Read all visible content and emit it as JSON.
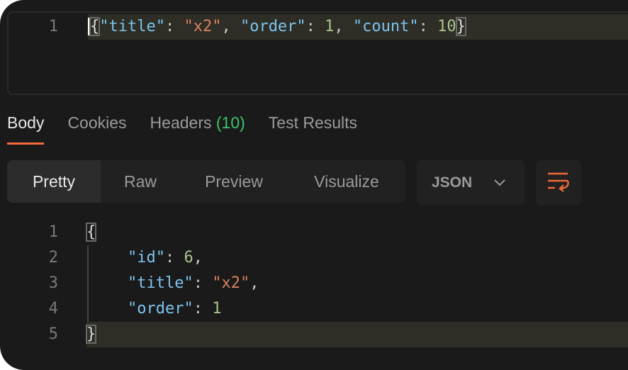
{
  "request": {
    "line_numbers": [
      "1"
    ],
    "open": "{",
    "k1": "\"title\"",
    "c1": ": ",
    "v1": "\"x2\"",
    "c2": ", ",
    "k2": "\"order\"",
    "c3": ": ",
    "v2": "1",
    "c4": ", ",
    "k3": "\"count\"",
    "c5": ": ",
    "v3": "10",
    "close": "}"
  },
  "tabs": [
    {
      "label": "Body"
    },
    {
      "label": "Cookies"
    },
    {
      "label": "Headers",
      "count": "(10)"
    },
    {
      "label": "Test Results"
    }
  ],
  "view_modes": [
    "Pretty",
    "Raw",
    "Preview",
    "Visualize"
  ],
  "format": {
    "selected": "JSON",
    "icon": "chevron-down-icon"
  },
  "wrap_button": {
    "icon": "text-wrap-icon",
    "color": "#f26b3a"
  },
  "response": {
    "line_numbers": [
      "1",
      "2",
      "3",
      "4",
      "5"
    ],
    "open": "{",
    "id_key": "\"id\"",
    "id_val": "6",
    "title_key": "\"title\"",
    "title_val": "\"x2\"",
    "order_key": "\"order\"",
    "order_val": "1",
    "close": "}",
    "colon": ": ",
    "comma": ","
  },
  "colors": {
    "accent": "#f26b3a",
    "key": "#7cc3ee",
    "string": "#d9825e",
    "number": "#a8c48c"
  }
}
